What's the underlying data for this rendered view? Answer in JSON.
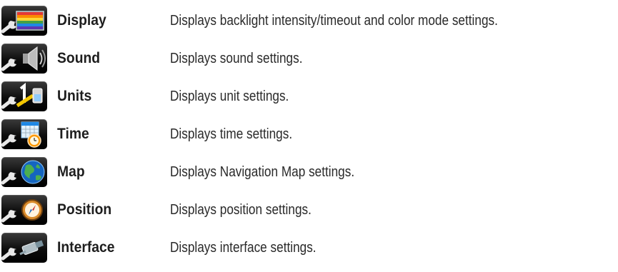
{
  "settings": [
    {
      "name": "Display",
      "description": "Displays backlight intensity/timeout and color mode settings.",
      "icon": "display-icon"
    },
    {
      "name": "Sound",
      "description": "Displays sound settings.",
      "icon": "sound-icon"
    },
    {
      "name": "Units",
      "description": "Displays unit settings.",
      "icon": "units-icon"
    },
    {
      "name": "Time",
      "description": "Displays time settings.",
      "icon": "time-icon"
    },
    {
      "name": "Map",
      "description": "Displays Navigation Map settings.",
      "icon": "map-icon"
    },
    {
      "name": "Position",
      "description": "Displays position settings.",
      "icon": "position-icon"
    },
    {
      "name": "Interface",
      "description": "Displays interface settings.",
      "icon": "interface-icon"
    }
  ],
  "colors": {
    "icon_background": "#000000",
    "wrench": "#e8e8e8",
    "text": "#222222"
  }
}
